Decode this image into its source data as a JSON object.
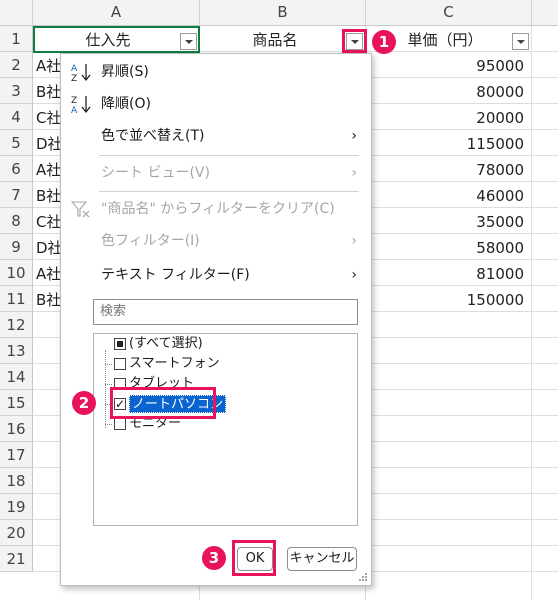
{
  "columns": [
    "A",
    "B",
    "C"
  ],
  "rows": [
    "1",
    "2",
    "3",
    "4",
    "5",
    "6",
    "7",
    "8",
    "9",
    "10",
    "11",
    "12",
    "13",
    "14",
    "15",
    "16",
    "17",
    "18",
    "19",
    "20",
    "21"
  ],
  "header": {
    "a1": "仕入先",
    "b1": "商品名",
    "c1": "単価（円）"
  },
  "col_a_visible": [
    "A社",
    "B社",
    "C社",
    "D社",
    "A社",
    "B社",
    "C社",
    "D社",
    "A社",
    "B社"
  ],
  "col_c_values": [
    "95000",
    "80000",
    "20000",
    "115000",
    "78000",
    "46000",
    "35000",
    "58000",
    "81000",
    "150000"
  ],
  "menu": {
    "sort_asc": "昇順(S)",
    "sort_desc": "降順(O)",
    "sort_by_color": "色で並べ替え(T)",
    "sheet_view": "シート ビュー(V)",
    "clear_filter": "\"商品名\" からフィルターをクリア(C)",
    "color_filter": "色フィルター(I)",
    "text_filter": "テキスト フィルター(F)",
    "search_placeholder": "検索",
    "items": [
      "(すべて選択)",
      "スマートフォン",
      "タブレット",
      "ノートパソコン",
      "モニター"
    ],
    "ok": "OK",
    "cancel": "キャンセル"
  },
  "callouts": [
    "1",
    "2",
    "3"
  ],
  "accent": {
    "callout": "#e8135b",
    "selection": "#107c41",
    "highlight": "#0a64d0"
  }
}
